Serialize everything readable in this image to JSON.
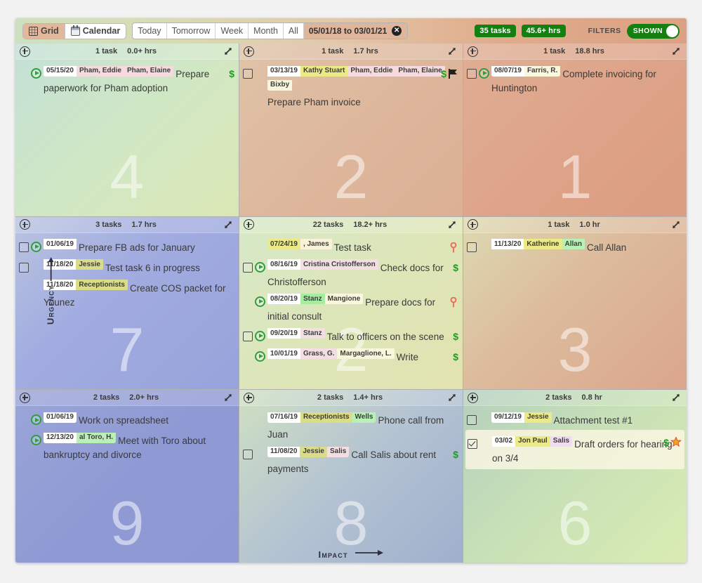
{
  "toolbar": {
    "view_grid": "Grid",
    "view_calendar": "Calendar",
    "ranges": [
      "Today",
      "Tomorrow",
      "Week",
      "Month",
      "All"
    ],
    "date_range": "05/01/18 to 03/01/21",
    "clear_range_icon": "close-circle-icon",
    "task_count": "35 tasks",
    "hours_total": "45.6+ hrs",
    "filters_label": "FILTERS",
    "filters_state": "SHOWN"
  },
  "axes": {
    "y_label": "Urgency",
    "x_label": "Impact"
  },
  "quadrants": [
    {
      "number": "4",
      "count": "1 task",
      "hours": "0.0+ hrs",
      "tasks": [
        {
          "checkbox": "none",
          "play": true,
          "chips": [
            {
              "text": "05/15/20",
              "style": "date"
            },
            {
              "text": "Pham, Eddie",
              "style": "pink"
            },
            {
              "text": "Pham, Elaine",
              "style": "pink"
            }
          ],
          "text": "Prepare paperwork for Pham adoption",
          "badges": [
            "dollar"
          ]
        }
      ]
    },
    {
      "number": "2",
      "count": "1 task",
      "hours": "1.7 hrs",
      "tasks": [
        {
          "checkbox": "unchecked",
          "play": false,
          "chips": [
            {
              "text": "03/13/19",
              "style": "date"
            },
            {
              "text": "Kathy Stuart",
              "style": "yellow"
            },
            {
              "text": "Pham, Eddie",
              "style": "pink"
            },
            {
              "text": "Pham, Elaine",
              "style": "pink"
            },
            {
              "text": "Bixby",
              "style": "cream"
            }
          ],
          "text": "Prepare Pham invoice",
          "badges": [
            "dollar",
            "flag"
          ]
        }
      ]
    },
    {
      "number": "1",
      "count": "1 task",
      "hours": "18.8 hrs",
      "tasks": [
        {
          "checkbox": "unchecked",
          "play": true,
          "chips": [
            {
              "text": "08/07/19",
              "style": "date"
            },
            {
              "text": "Farris, R.",
              "style": "cream"
            }
          ],
          "text": "Complete invoicing for Huntington",
          "badges": []
        }
      ]
    },
    {
      "number": "7",
      "count": "3 tasks",
      "hours": "1.7 hrs",
      "tasks": [
        {
          "checkbox": "unchecked",
          "play": true,
          "chips": [
            {
              "text": "01/06/19",
              "style": "date"
            }
          ],
          "text": "Prepare FB ads for January",
          "badges": []
        },
        {
          "checkbox": "unchecked",
          "play": false,
          "chips": [
            {
              "text": "11/18/20",
              "style": "date"
            },
            {
              "text": "Jessie",
              "style": "olive"
            }
          ],
          "text": "Test task 6 in progress",
          "badges": []
        },
        {
          "checkbox": "none",
          "play": false,
          "chips": [
            {
              "text": "11/18/20",
              "style": "date"
            },
            {
              "text": "Receptionists",
              "style": "olive"
            }
          ],
          "text": "Create COS packet for Younez",
          "badges": []
        }
      ]
    },
    {
      "number": "2",
      "count": "22 tasks",
      "hours": "18.2+ hrs",
      "tasks": [
        {
          "checkbox": "none",
          "play": false,
          "chips": [
            {
              "text": "07/24/19",
              "style": "yellow"
            },
            {
              "text": ", James",
              "style": "pale"
            }
          ],
          "chips_prefix": {
            "text": "07/24/19",
            "style": "date"
          },
          "text": "Test task",
          "badges": [
            "key"
          ]
        },
        {
          "checkbox": "unchecked",
          "play": true,
          "chips": [
            {
              "text": "08/16/19",
              "style": "date"
            },
            {
              "text": "Cristina Cristofferson",
              "style": "rose"
            }
          ],
          "text": "Check docs for Christofferson",
          "badges": [
            "dollar"
          ]
        },
        {
          "checkbox": "none",
          "play": true,
          "chips": [
            {
              "text": "08/20/19",
              "style": "date"
            },
            {
              "text": "Stanz",
              "style": "green"
            },
            {
              "text": "Mangione",
              "style": "cream"
            }
          ],
          "text": "Prepare docs for initial consult",
          "badges": [
            "key"
          ]
        },
        {
          "checkbox": "unchecked",
          "play": true,
          "chips": [
            {
              "text": "09/20/19",
              "style": "date"
            },
            {
              "text": "Stanz",
              "style": "rose"
            }
          ],
          "text": "Talk to officers on the scene",
          "badges": [
            "dollar"
          ]
        },
        {
          "checkbox": "none",
          "play": true,
          "chips": [
            {
              "text": "10/01/19",
              "style": "date"
            },
            {
              "text": "Grass, G.",
              "style": "rose"
            },
            {
              "text": "Margaglione, L.",
              "style": "cream"
            }
          ],
          "text": "Write",
          "badges": [
            "dollar"
          ]
        }
      ]
    },
    {
      "number": "3",
      "count": "1 task",
      "hours": "1.0 hr",
      "tasks": [
        {
          "checkbox": "unchecked",
          "play": false,
          "chips": [
            {
              "text": "11/13/20",
              "style": "date"
            },
            {
              "text": "Katherine",
              "style": "yellow"
            },
            {
              "text": "Allan",
              "style": "mint"
            }
          ],
          "text": "Call Allan",
          "badges": []
        }
      ]
    },
    {
      "number": "9",
      "count": "2 tasks",
      "hours": "2.0+ hrs",
      "tasks": [
        {
          "checkbox": "none",
          "play": true,
          "chips": [
            {
              "text": "01/06/19",
              "style": "date"
            }
          ],
          "text": "Work on spreadsheet",
          "badges": []
        },
        {
          "checkbox": "none",
          "play": true,
          "chips": [
            {
              "text": "12/13/20",
              "style": "date"
            },
            {
              "text": "al Toro, H.",
              "style": "mint"
            }
          ],
          "text": "Meet with Toro about bankruptcy and divorce",
          "badges": []
        }
      ]
    },
    {
      "number": "8",
      "count": "2 tasks",
      "hours": "1.4+ hrs",
      "tasks": [
        {
          "checkbox": "none",
          "play": false,
          "chips": [
            {
              "text": "07/16/19",
              "style": "date"
            },
            {
              "text": "Receptionists",
              "style": "olive"
            },
            {
              "text": "Wells",
              "style": "mint"
            }
          ],
          "text": "Phone call from Juan",
          "badges": []
        },
        {
          "checkbox": "unchecked",
          "play": false,
          "chips": [
            {
              "text": "11/08/20",
              "style": "date"
            },
            {
              "text": "Jessie",
              "style": "olive"
            },
            {
              "text": "Salis",
              "style": "rose"
            }
          ],
          "text": "Call Salis about rent payments",
          "badges": [
            "dollar"
          ]
        }
      ]
    },
    {
      "number": "6",
      "count": "2 tasks",
      "hours": "0.8 hr",
      "tasks": [
        {
          "checkbox": "unchecked",
          "play": false,
          "chips": [
            {
              "text": "09/12/19",
              "style": "date"
            },
            {
              "text": "Jessie",
              "style": "yellow"
            }
          ],
          "text": "Attachment test #1",
          "badges": []
        },
        {
          "checkbox": "checked",
          "play": false,
          "highlight": true,
          "chips": [
            {
              "text": "03/02",
              "style": "date"
            },
            {
              "text": "Jon Paul",
              "style": "yellow"
            },
            {
              "text": "Salis",
              "style": "lav"
            }
          ],
          "text": "Draft orders for hearing on 3/4",
          "badges": [
            "dollar",
            "star"
          ]
        }
      ]
    }
  ],
  "colors": {
    "accent_green": "#138010",
    "dollar_green": "#19a11f",
    "quad_tl": "#cfe6c8",
    "quad_tm": "#ddb59a",
    "quad_tr": "#dda287",
    "quad_ml": "#9aa4d6",
    "quad_mm": "#dce5ba",
    "quad_mr": "#dba68d",
    "quad_bl": "#8e99d4",
    "quad_bm": "#a8b9cf",
    "quad_br": "#cfe2b6"
  }
}
